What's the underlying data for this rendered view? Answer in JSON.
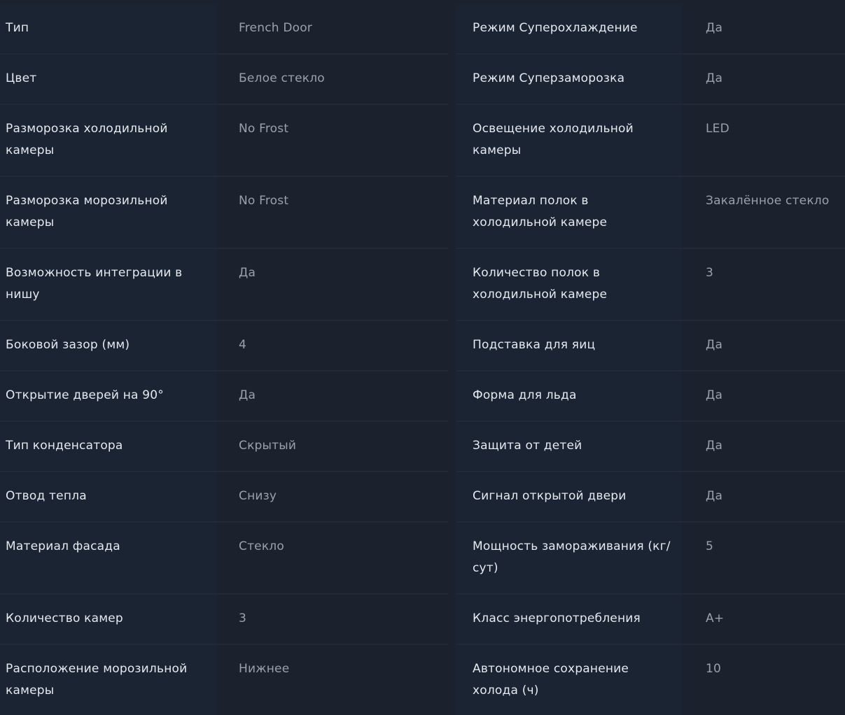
{
  "specs": {
    "left": [
      {
        "label": "Тип",
        "value": "French Door"
      },
      {
        "label": "Цвет",
        "value": "Белое стекло"
      },
      {
        "label": "Разморозка холодильной камеры",
        "value": "No Frost"
      },
      {
        "label": "Разморозка морозильной камеры",
        "value": "No Frost"
      },
      {
        "label": "Возможность интеграции в нишу",
        "value": "Да"
      },
      {
        "label": "Боковой зазор (мм)",
        "value": "4"
      },
      {
        "label": "Открытие дверей на 90°",
        "value": "Да"
      },
      {
        "label": "Тип конденсатора",
        "value": "Скрытый"
      },
      {
        "label": "Отвод тепла",
        "value": "Снизу"
      },
      {
        "label": "Материал фасада",
        "value": "Стекло"
      },
      {
        "label": "Количество камер",
        "value": "3"
      },
      {
        "label": "Расположение морозильной камеры",
        "value": "Нижнее"
      }
    ],
    "right": [
      {
        "label": "Режим Суперохлаждение",
        "value": "Да"
      },
      {
        "label": "Режим Суперзаморозка",
        "value": "Да"
      },
      {
        "label": "Освещение холодильной камеры",
        "value": "LED"
      },
      {
        "label": "Материал полок в холодильной камере",
        "value": "Закалённое стекло"
      },
      {
        "label": "Количество полок в холодильной камере",
        "value": "3"
      },
      {
        "label": "Подставка для яиц",
        "value": "Да"
      },
      {
        "label": "Форма для льда",
        "value": "Да"
      },
      {
        "label": "Защита от детей",
        "value": "Да"
      },
      {
        "label": "Сигнал открытой двери",
        "value": "Да"
      },
      {
        "label": "Мощность замораживания (кг/сут)",
        "value": "5"
      },
      {
        "label": "Класс энергопотребления",
        "value": "A+"
      },
      {
        "label": "Автономное сохранение холода (ч)",
        "value": "10"
      }
    ]
  }
}
